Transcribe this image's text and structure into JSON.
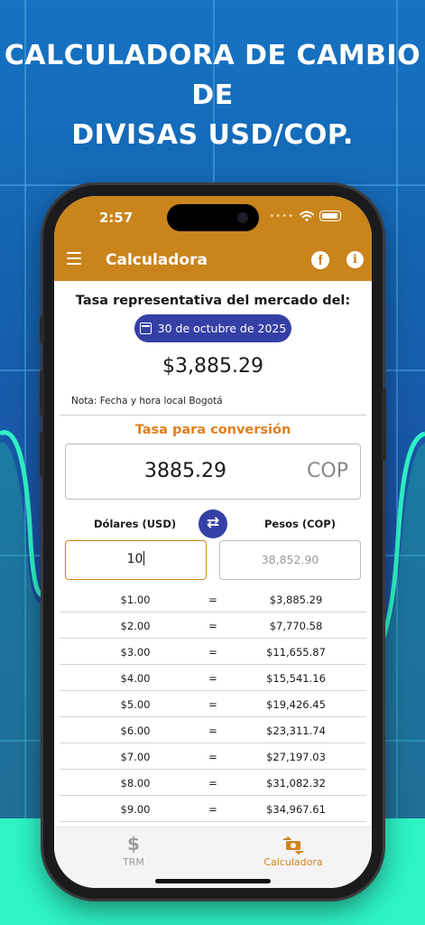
{
  "headline": {
    "line1": "CALCULADORA DE CAMBIO DE",
    "line2": "DIVISAS USD/COP."
  },
  "status_bar": {
    "time": "2:57"
  },
  "app_bar": {
    "title": "Calculadora"
  },
  "trm": {
    "title": "Tasa representativa del mercado del:",
    "date": "30 de octubre de 2025",
    "value": "$3,885.29",
    "note": "Nota: Fecha y hora local Bogotá"
  },
  "conversion": {
    "title": "Tasa para conversión",
    "rate": "3885.29",
    "rate_suffix": "COP"
  },
  "converter": {
    "usd_label": "Dólares (USD)",
    "cop_label": "Pesos (COP)",
    "usd_value": "10",
    "cop_placeholder": "38,852.90"
  },
  "table_rows": [
    {
      "usd": "$1.00",
      "eq": "=",
      "cop": "$3,885.29"
    },
    {
      "usd": "$2.00",
      "eq": "=",
      "cop": "$7,770.58"
    },
    {
      "usd": "$3.00",
      "eq": "=",
      "cop": "$11,655.87"
    },
    {
      "usd": "$4.00",
      "eq": "=",
      "cop": "$15,541.16"
    },
    {
      "usd": "$5.00",
      "eq": "=",
      "cop": "$19,426.45"
    },
    {
      "usd": "$6.00",
      "eq": "=",
      "cop": "$23,311.74"
    },
    {
      "usd": "$7.00",
      "eq": "=",
      "cop": "$27,197.03"
    },
    {
      "usd": "$8.00",
      "eq": "=",
      "cop": "$31,082.32"
    },
    {
      "usd": "$9.00",
      "eq": "=",
      "cop": "$34,967.61"
    }
  ],
  "bottom_nav": {
    "trm_label": "TRM",
    "calc_label": "Calculadora",
    "active": "Calculadora"
  },
  "icons": {
    "menu": "menu-icon",
    "facebook": "facebook-icon",
    "info": "info-icon",
    "calendar": "calendar-icon",
    "swap": "swap-icon",
    "dollar": "dollar-icon",
    "exchange": "exchange-icon"
  },
  "colors": {
    "accent_orange": "#c9841c",
    "primary_blue": "#3540a6",
    "active_nav": "#d0841e",
    "background_teal": "#2ef3c5"
  }
}
